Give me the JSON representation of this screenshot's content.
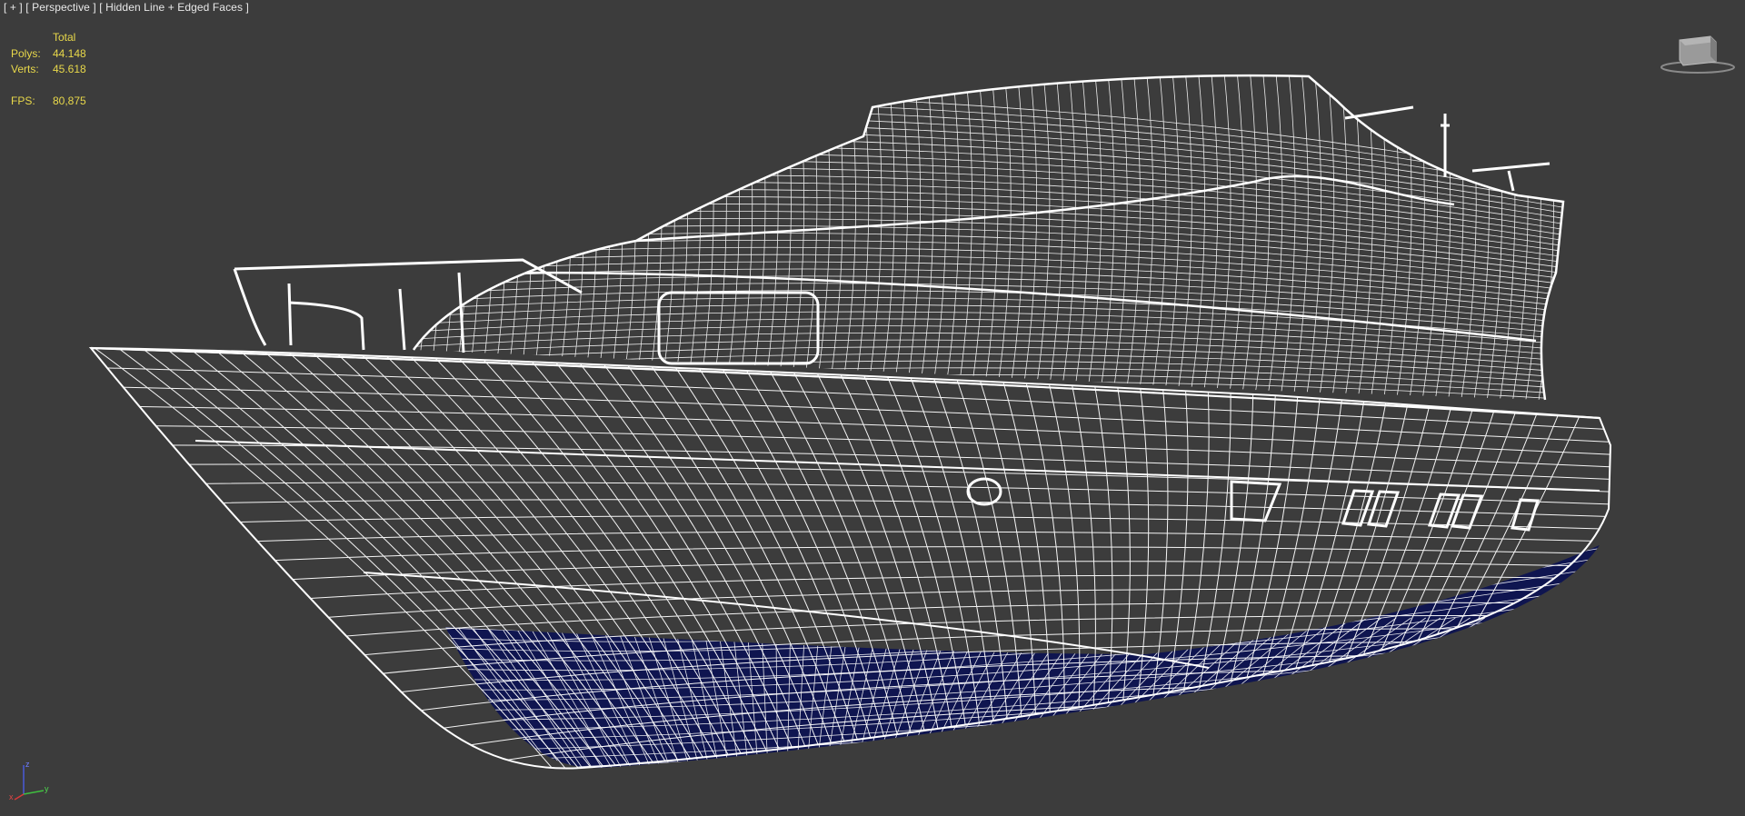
{
  "viewport": {
    "menu_plus": "[ + ]",
    "view_name": "[ Perspective ]",
    "shading_mode": "[ Hidden Line + Edged Faces ]"
  },
  "stats": {
    "header": "Total",
    "polys_label": "Polys:",
    "polys_value": "44.148",
    "verts_label": "Verts:",
    "verts_value": "45.618",
    "fps_label": "FPS:",
    "fps_value": "80,875"
  },
  "colors": {
    "background": "#3c3c3c",
    "wire": "#ffffff",
    "hull_bottom": "#0f1550",
    "stats_text": "#e8d84a",
    "label_text": "#e8e8e8"
  },
  "icons": {
    "viewcube": "viewcube-icon",
    "axis": "xyz-axis-tripod-icon"
  },
  "axis_labels": {
    "z": "z",
    "x": "x",
    "y": "y"
  }
}
